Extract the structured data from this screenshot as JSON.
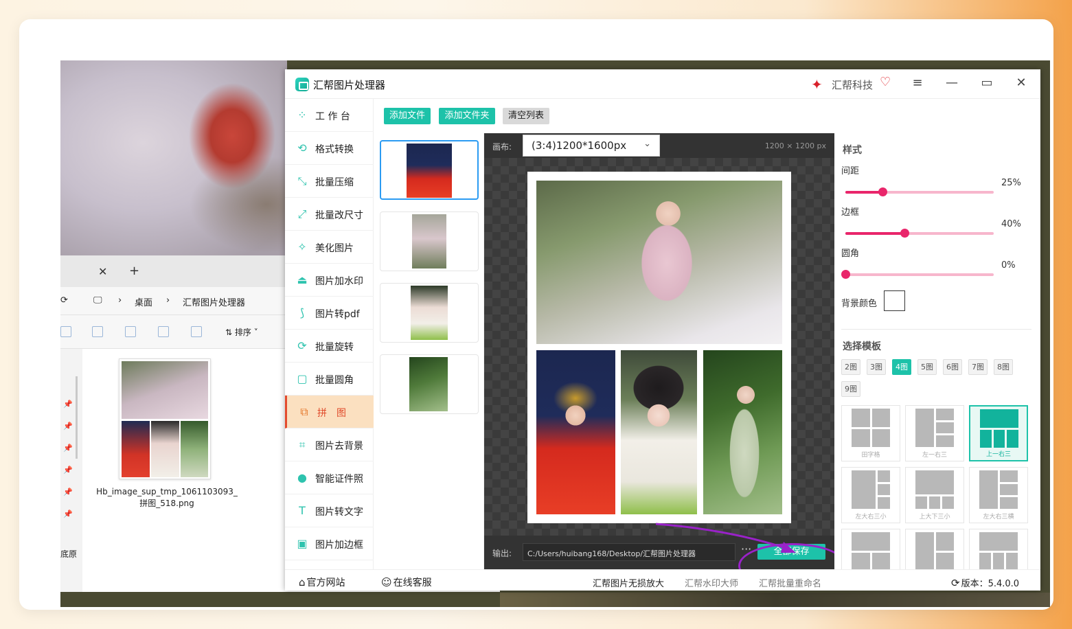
{
  "explorer": {
    "tab_close": "✕",
    "tab_add": "+",
    "breadcrumb": [
      "桌面",
      "汇帮图片处理器"
    ],
    "sort_label": "排序",
    "file_name": "Hb_image_sup_tmp_1061103093_拼图_518.png",
    "truncated_label": "底原"
  },
  "app": {
    "title": "汇帮图片处理器",
    "brand": "汇帮科技",
    "window_buttons": [
      "≡",
      "—",
      "▭",
      "✕"
    ],
    "sidebar": [
      {
        "icon": "workbench-icon",
        "glyph": "⁘",
        "label": "工 作 台"
      },
      {
        "icon": "format-convert-icon",
        "glyph": "⟲",
        "label": "格式转换"
      },
      {
        "icon": "compress-icon",
        "glyph": "⤡",
        "label": "批量压缩"
      },
      {
        "icon": "resize-icon",
        "glyph": "⤢",
        "label": "批量改尺寸"
      },
      {
        "icon": "beautify-icon",
        "glyph": "✧",
        "label": "美化图片"
      },
      {
        "icon": "watermark-icon",
        "glyph": "⏏",
        "label": "图片加水印"
      },
      {
        "icon": "pdf-icon",
        "glyph": "⟆",
        "label": "图片转pdf"
      },
      {
        "icon": "rotate-icon",
        "glyph": "⟳",
        "label": "批量旋转"
      },
      {
        "icon": "round-corner-icon",
        "glyph": "▢",
        "label": "批量圆角"
      },
      {
        "icon": "collage-icon",
        "glyph": "⧉",
        "label": "拼　图",
        "active": true
      },
      {
        "icon": "remove-bg-icon",
        "glyph": "⌗",
        "label": "图片去背景"
      },
      {
        "icon": "id-photo-icon",
        "glyph": "●",
        "label": "智能证件照"
      },
      {
        "icon": "ocr-icon",
        "glyph": "T",
        "label": "图片转文字"
      },
      {
        "icon": "border-icon",
        "glyph": "▣",
        "label": "图片加边框"
      }
    ],
    "toolbar": {
      "add_file": "添加文件",
      "add_folder": "添加文件夹",
      "clear_list": "清空列表"
    },
    "preview": {
      "canvas_label": "画布:",
      "canvas_value": "(3:4)1200*1600px",
      "canvas_size": "1200 × 1200 px",
      "output_label": "输出:",
      "output_path": "C:/Users/huibang168/Desktop/汇帮图片处理器",
      "more": "···",
      "save_all": "全部保存"
    },
    "style_panel": {
      "title": "样式",
      "spacing_label": "间距",
      "spacing_value": "25%",
      "spacing": 0.25,
      "border_label": "边框",
      "border_value": "40%",
      "border": 0.4,
      "radius_label": "圆角",
      "radius_value": "0%",
      "radius": 0.0,
      "bg_color_label": "背景颜色",
      "bg_color": "#ffffff"
    },
    "template_panel": {
      "title": "选择模板",
      "counts": [
        "2图",
        "3图",
        "4图",
        "5图",
        "6图",
        "7图",
        "8图",
        "9图"
      ],
      "active_count": "4图",
      "templates": [
        {
          "caption": "田字格"
        },
        {
          "caption": "左一右三"
        },
        {
          "caption": "上一右三",
          "active": true
        },
        {
          "caption": "左大右三小"
        },
        {
          "caption": "上大下三小"
        },
        {
          "caption": "左大右三横"
        }
      ]
    },
    "statusbar": {
      "website": "官方网站",
      "support": "在线客服",
      "link1": "汇帮图片无损放大",
      "link2": "汇帮水印大师",
      "link3": "汇帮批量重命名",
      "version": "版本：5.4.0.0"
    },
    "colors": {
      "accent": "#1dc2a9",
      "slider": "#e9266b",
      "active_nav": "#fbe0c0",
      "annotation": "#9a22c9"
    }
  }
}
